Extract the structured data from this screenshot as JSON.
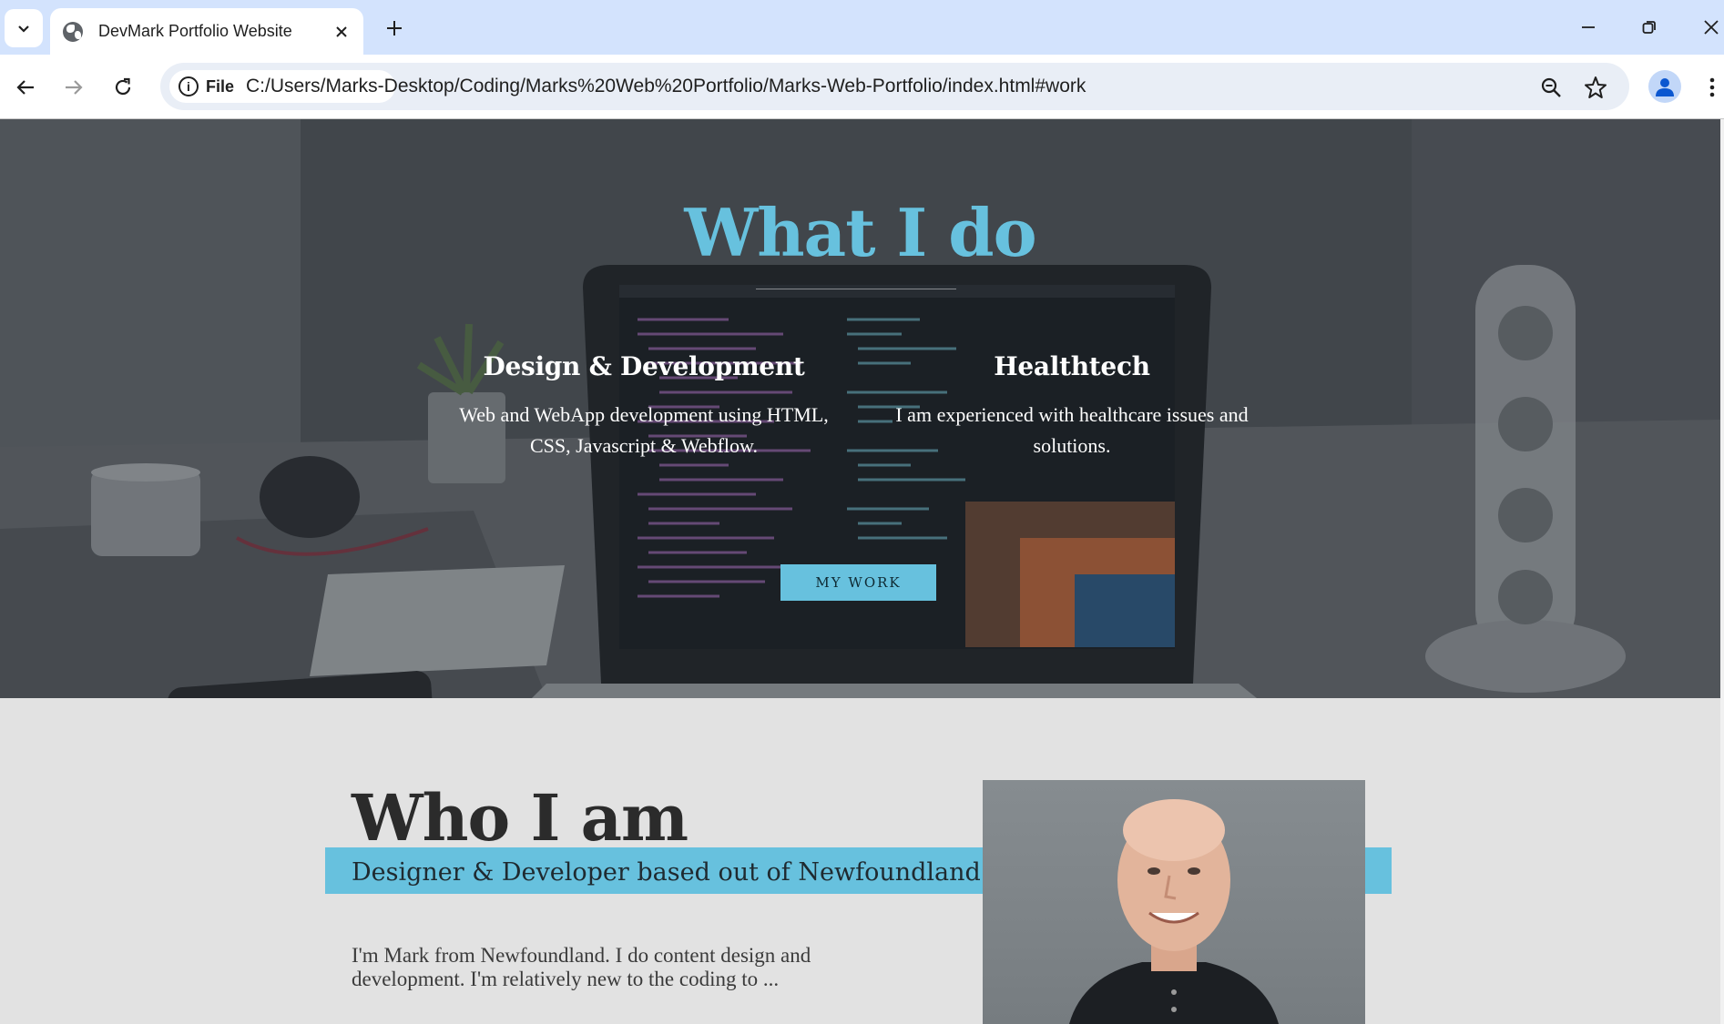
{
  "browser": {
    "tab_title": "DevMark Portfolio Website",
    "address_chip_label": "File",
    "url": "C:/Users/Marks-Desktop/Coding/Marks%20Web%20Portfolio/Marks-Web-Portfolio/index.html#work",
    "icons": [
      "tab-search-icon",
      "globe-icon",
      "close-icon",
      "plus-icon",
      "minimize-icon",
      "restore-icon",
      "window-close-icon",
      "back-arrow-icon",
      "forward-arrow-icon",
      "reload-icon",
      "info-icon",
      "zoom-icon",
      "star-icon",
      "profile-icon",
      "more-vert-icon"
    ]
  },
  "hero": {
    "title": "What I do",
    "services": [
      {
        "title": "Design & Development",
        "description": "Web and WebApp development using HTML, CSS, Javascript & Webflow."
      },
      {
        "title": "Healthtech",
        "description": "I am experienced with healthcare issues and solutions."
      }
    ],
    "button_label": "MY WORK"
  },
  "about": {
    "title": "Who I am",
    "subtitle": "Designer & Developer based out of Newfoundland",
    "paragraph": "I'm Mark from Newfoundland. I do content design and development. I'm relatively new to the coding to ..."
  },
  "colors": {
    "accent": "#67c1de",
    "tabstrip": "#d3e3fd",
    "page_background": "#e2e2e2",
    "heading_text": "#2b2b2b"
  }
}
